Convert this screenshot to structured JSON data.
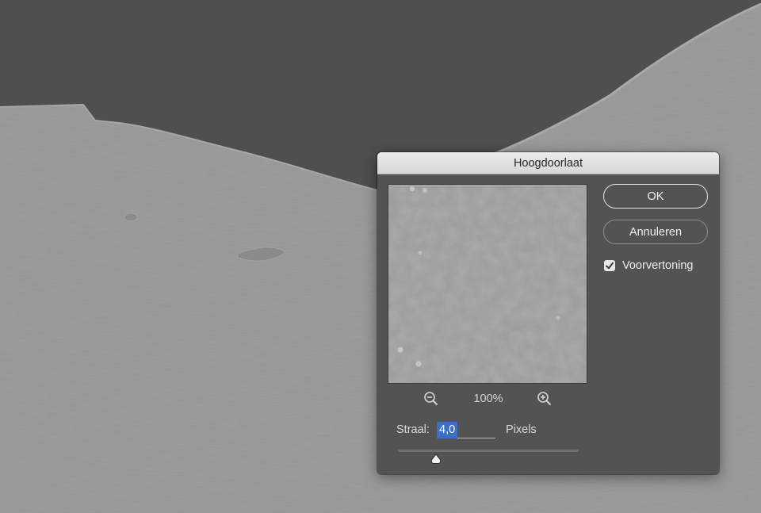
{
  "dialog": {
    "title": "Hoogdoorlaat",
    "zoom_level": "100%",
    "ok_label": "OK",
    "cancel_label": "Annuleren",
    "preview_label": "Voorvertoning",
    "preview_checked": true,
    "radius_label": "Straal:",
    "radius_value": "4,0",
    "radius_unit": "Pixels",
    "radius_slider_fraction": 0.21
  },
  "icons": {
    "zoom_out": "zoom-out-icon",
    "zoom_in": "zoom-in-icon",
    "checkmark": "checkmark-icon",
    "slider_thumb": "slider-thumb-icon"
  },
  "colors": {
    "dialog_bg": "#535353",
    "titlebar_bg": "#dedede",
    "selection_blue": "#3a6fc4",
    "canvas_gray": "#8f8f8f",
    "sky_dark": "#4f4f4f"
  }
}
